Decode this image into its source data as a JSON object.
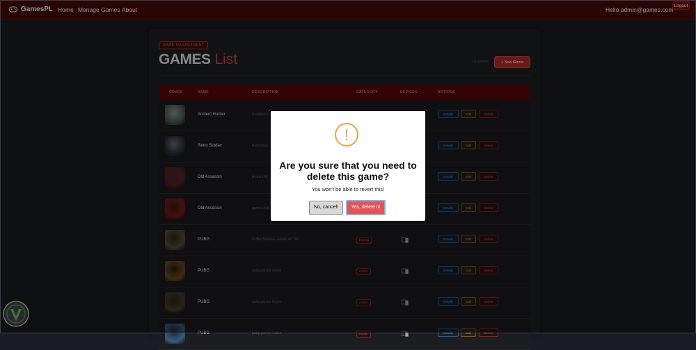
{
  "navbar": {
    "brand": "GamesPL",
    "links": [
      "Home",
      "Manage Games",
      "About"
    ],
    "greeting": "Hello admin@games.com",
    "logout": "Logout"
  },
  "page": {
    "badge": "GAME MANAGEMENT",
    "title_a": "GAMES",
    "title_b": "List",
    "count": "10 games",
    "new_button": "+ New Game"
  },
  "table": {
    "headers": [
      "COVER",
      "NAME",
      "DESCRIPTION",
      "CATEGORY",
      "DEVICES",
      "ACTIONS"
    ],
    "actions": {
      "details": "Details",
      "edit": "Edit",
      "delete": "Delete"
    },
    "rows": [
      {
        "name": "Ancient Hunter",
        "desc": "A skilled h",
        "category": ""
      },
      {
        "name": "Retro Soldier",
        "desc": "A strong p",
        "category": ""
      },
      {
        "name": "Old Assassin",
        "desc": "A silent kil",
        "category": ""
      },
      {
        "name": "Old Assassin",
        "desc": "games Acti",
        "category": ""
      },
      {
        "name": "PUBG",
        "desc": "PUBG MOBILE GAME ACTIN",
        "category": "Racing"
      },
      {
        "name": "PUBG",
        "desc": "pubg games action",
        "category": "Action"
      },
      {
        "name": "PUBG",
        "desc": "pubg games Action",
        "category": "Action"
      },
      {
        "name": "PUBG",
        "desc": "pubg games Action",
        "category": "Action"
      }
    ]
  },
  "modal": {
    "icon": "!",
    "title": "Are you sure that you need to delete this game?",
    "text": "You won't be able to revert this!",
    "cancel": "No, cancel!",
    "confirm": "Yes, delete it!"
  },
  "colors": {
    "navbar": "#4a0707",
    "accent": "#d64545",
    "warning": "#f0a04b"
  }
}
